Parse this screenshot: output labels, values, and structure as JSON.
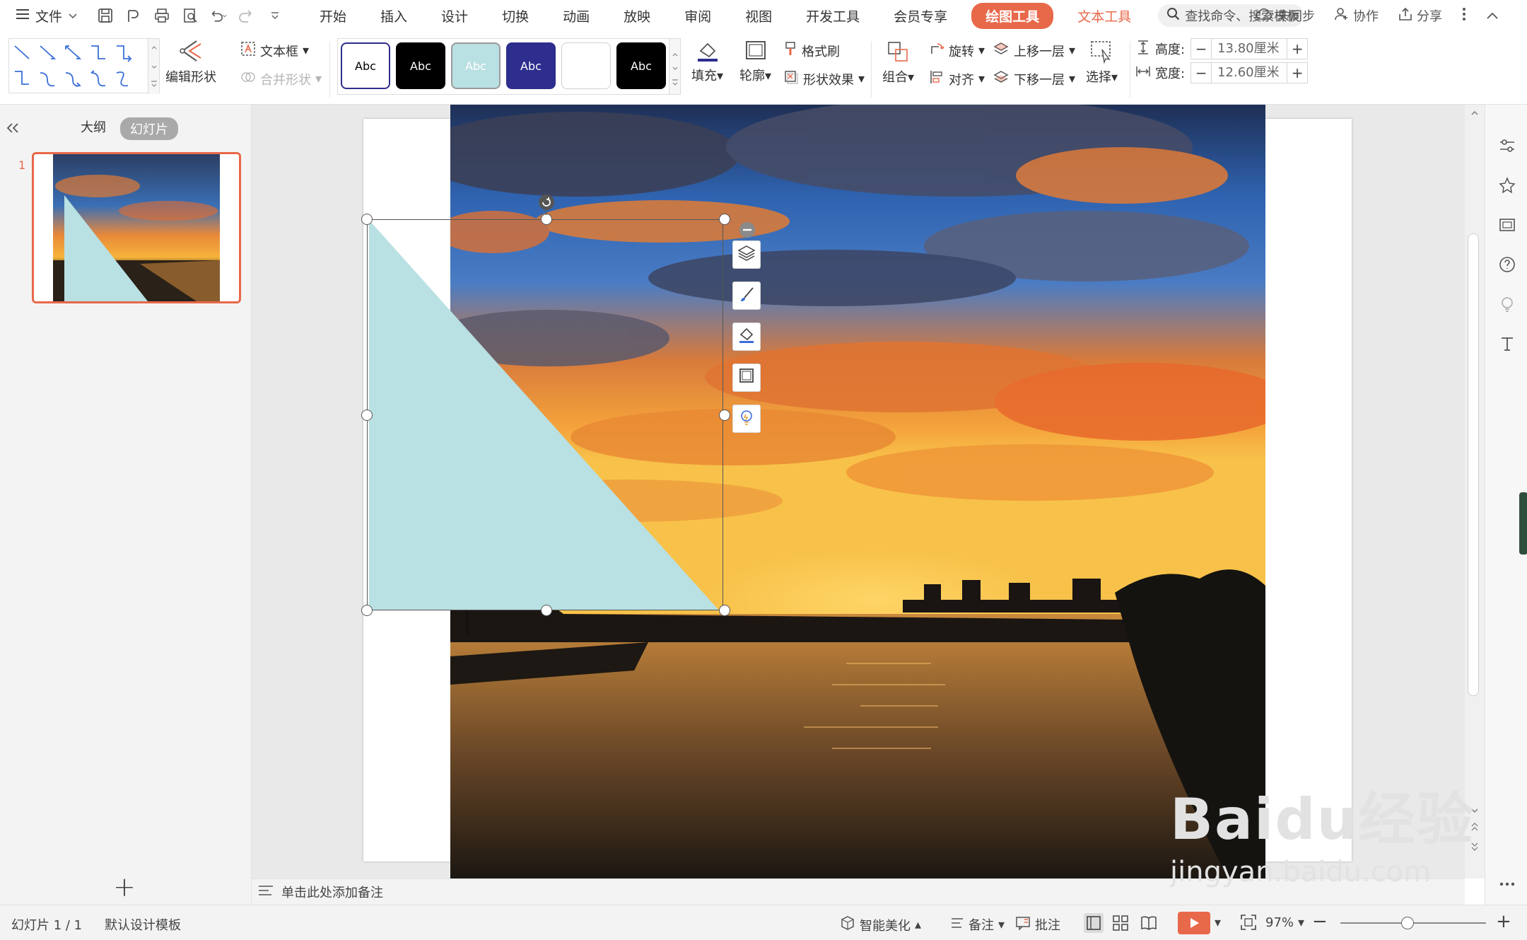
{
  "menubar": {
    "file_label": "文件",
    "tabs": [
      "开始",
      "插入",
      "设计",
      "切换",
      "动画",
      "放映",
      "审阅",
      "视图",
      "开发工具",
      "会员专享"
    ],
    "draw_tools": "绘图工具",
    "text_tools": "文本工具",
    "search_placeholder": "查找命令、搜索模板",
    "sync": "未同步",
    "collab": "协作",
    "share": "分享"
  },
  "ribbon": {
    "edit_shape": "编辑形状",
    "textbox": "文本框",
    "merge_shapes": "合并形状",
    "style_label": "Abc",
    "fill": "填充",
    "outline": "轮廓",
    "format_painter": "格式刷",
    "shape_effects": "形状效果",
    "group": "组合",
    "rotate": "旋转",
    "align": "对齐",
    "bring_forward": "上移一层",
    "send_backward": "下移一层",
    "select": "选择",
    "height_label": "高度:",
    "height_value": "13.80厘米",
    "width_label": "宽度:",
    "width_value": "12.60厘米",
    "minus": "−",
    "plus": "+"
  },
  "leftpanel": {
    "outline_tab": "大纲",
    "slides_tab": "幻灯片",
    "slide_number": "1",
    "add": "+"
  },
  "notes": {
    "placeholder": "单击此处添加备注"
  },
  "statusbar": {
    "slide_info": "幻灯片 1 / 1",
    "template": "默认设计模板",
    "smart_beautify": "智能美化",
    "notes": "备注",
    "comments": "批注",
    "zoom": "97%",
    "zoom_minus": "−",
    "zoom_plus": "+"
  },
  "watermark": {
    "text": "Baidu经验",
    "sub": "jingyan.baidu.com"
  },
  "colors": {
    "accent": "#e8684a",
    "shape_fill": "#b9e0e2",
    "style_dark_blue": "#2e2e8e"
  }
}
